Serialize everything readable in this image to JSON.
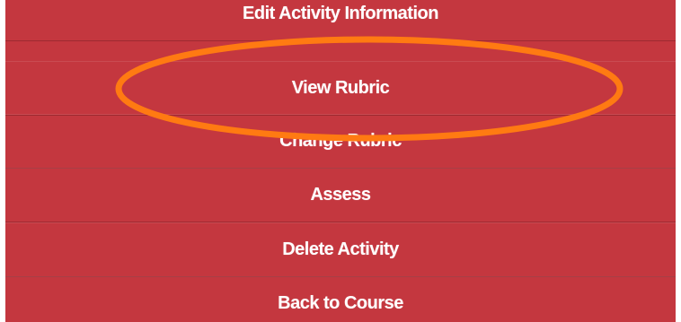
{
  "menu": {
    "items": [
      {
        "label": "Edit Activity Information"
      },
      {
        "label": "View Rubric"
      },
      {
        "label": "Change Rubric"
      },
      {
        "label": "Assess"
      },
      {
        "label": "Delete Activity"
      },
      {
        "label": "Back to Course"
      }
    ]
  },
  "annotation": {
    "highlighted_item": "View Rubric",
    "color": "#ff7a12"
  },
  "colors": {
    "menu_background": "#c4373f",
    "divider": "#9d2a31",
    "text": "#ffffff"
  }
}
